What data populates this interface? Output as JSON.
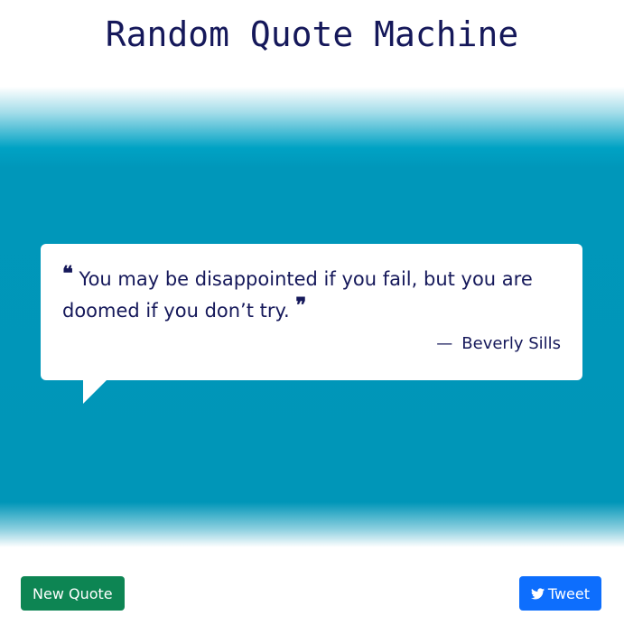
{
  "page": {
    "title": "Random Quote Machine"
  },
  "quote": {
    "text": "You may be disappointed if you fail, but you are doomed if you don’t try.",
    "open_mark": "❝",
    "close_mark": "❞",
    "author_dash": "—",
    "author": "Beverly Sills"
  },
  "actions": {
    "new_quote_label": "New Quote",
    "tweet_label": "Tweet",
    "tweet_icon": "twitter-icon"
  },
  "colors": {
    "title_text": "#15185a",
    "band": "#0096b8",
    "new_quote_button": "#0d8553",
    "tweet_button": "#0d6efd"
  }
}
